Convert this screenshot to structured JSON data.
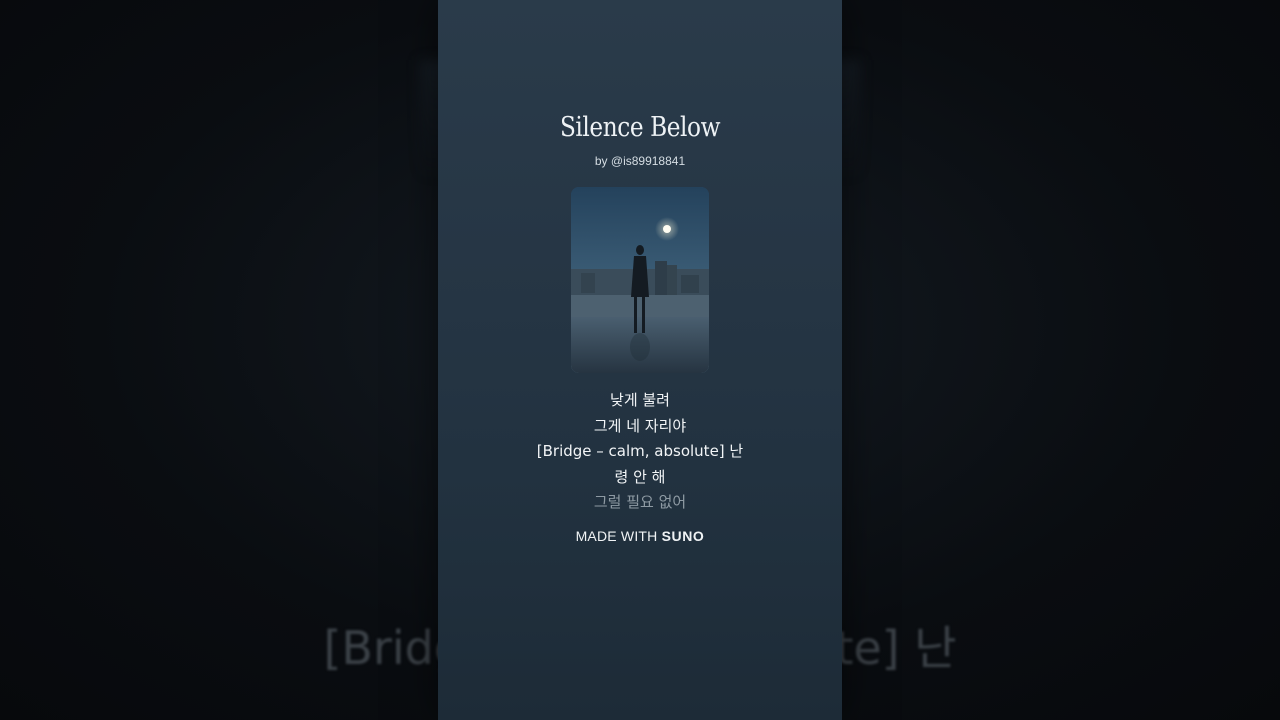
{
  "song": {
    "title": "Silence Below",
    "artist": "by @is89918841"
  },
  "cover": {
    "icon": "album-cover-image"
  },
  "lyrics": {
    "lines": [
      "낮게 불려",
      "그게 네 자리야",
      "[Bridge – calm, absolute] 난",
      "령 안 해",
      "그럴 필요 없어"
    ]
  },
  "footer": {
    "made_with": "MADE WITH",
    "brand": "SUNO"
  },
  "background": {
    "ghost_text": "[Bridge – calm, absolute] 난"
  },
  "colors": {
    "panel": "#263645",
    "text": "#f2f5f7",
    "dim_text": "#8e9aa3"
  }
}
